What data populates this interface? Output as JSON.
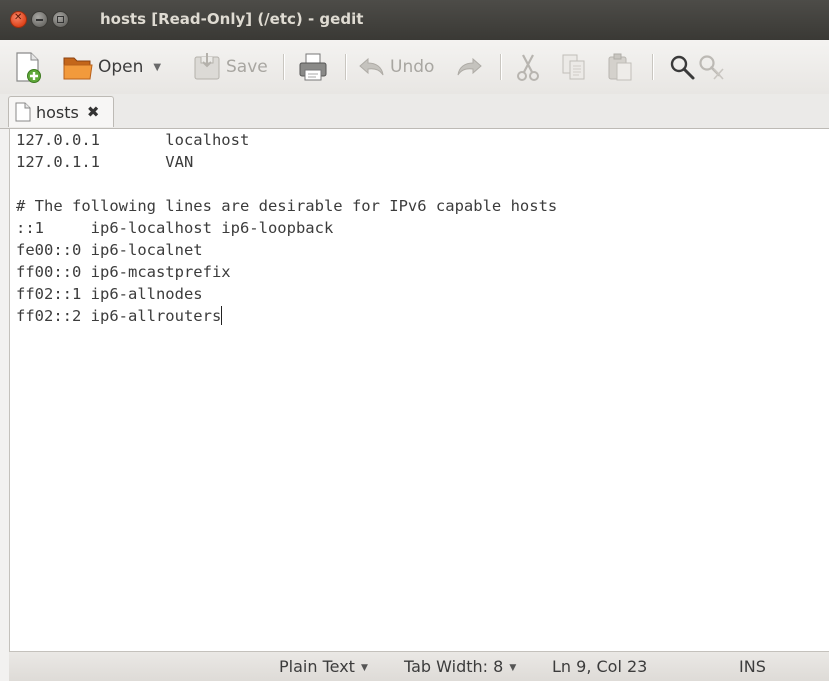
{
  "window": {
    "title": "hosts [Read-Only] (/etc) - gedit"
  },
  "toolbar": {
    "new_icon": "new-document-icon",
    "open_label": "Open",
    "save_label": "Save",
    "print_icon": "print-icon",
    "undo_label": "Undo",
    "redo_icon": "redo-icon",
    "cut_icon": "cut-icon",
    "copy_icon": "copy-icon",
    "paste_icon": "paste-icon",
    "find_icon": "search-icon",
    "replace_icon": "search-replace-icon"
  },
  "tabs": [
    {
      "label": "hosts",
      "close_glyph": "✖"
    }
  ],
  "editor": {
    "lines": [
      "127.0.0.1       localhost",
      "127.0.1.1       VAN",
      "",
      "# The following lines are desirable for IPv6 capable hosts",
      "::1     ip6-localhost ip6-loopback",
      "fe00::0 ip6-localnet",
      "ff00::0 ip6-mcastprefix",
      "ff02::1 ip6-allnodes",
      "ff02::2 ip6-allrouters"
    ]
  },
  "statusbar": {
    "language": "Plain Text",
    "tab_width": "Tab Width:  8",
    "position": "Ln 9, Col 23",
    "mode": "INS"
  },
  "colors": {
    "titlebar": "#3c3b37",
    "close_button": "#e0451c",
    "editor_bg": "#ffffff",
    "window_bg": "#f2f1f0"
  }
}
